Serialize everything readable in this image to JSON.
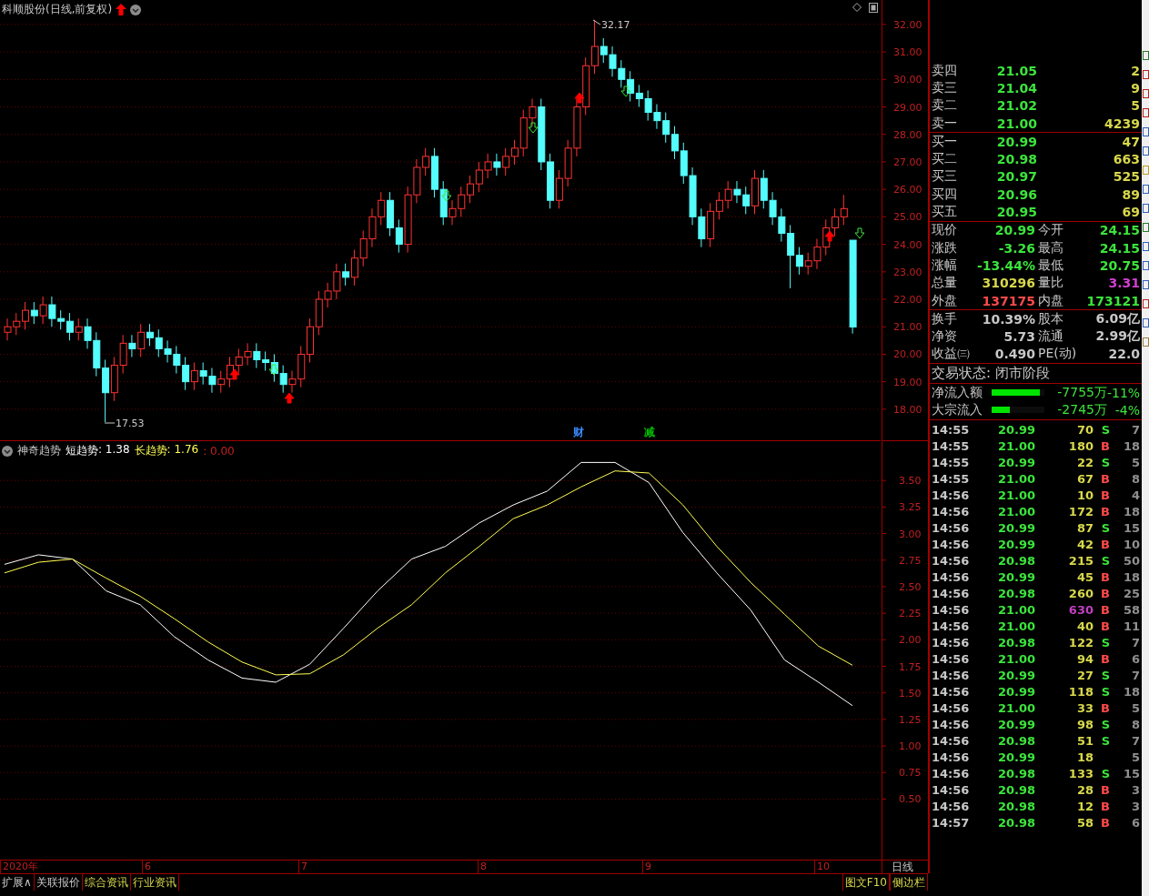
{
  "chart": {
    "title": "科顺股份(日线,前复权)",
    "high_label": "32.17",
    "low_label": "17.53",
    "event_marks": [
      {
        "label": "财",
        "color": "#3c8cff"
      },
      {
        "label": "减",
        "color": "#00c000"
      }
    ],
    "chart_data": {
      "type": "candlestick",
      "grid": true,
      "ylim": [
        16.87,
        32.89
      ],
      "yticks": [
        {
          "value": 32,
          "label": "32.00"
        },
        {
          "value": 31,
          "label": "31.00"
        },
        {
          "value": 30,
          "label": "30.00"
        },
        {
          "value": 29,
          "label": "29.00"
        },
        {
          "value": 28,
          "label": "28.00"
        },
        {
          "value": 27,
          "label": "27.00"
        },
        {
          "value": 26,
          "label": "26.00"
        },
        {
          "value": 25,
          "label": "25.00"
        },
        {
          "value": 24,
          "label": "24.00"
        },
        {
          "value": 23,
          "label": "23.00"
        },
        {
          "value": 22,
          "label": "22.00"
        },
        {
          "value": 21,
          "label": "21.00"
        },
        {
          "value": 20,
          "label": "20.00"
        },
        {
          "value": 19,
          "label": "19.00"
        },
        {
          "value": 18,
          "label": "18.00"
        }
      ],
      "ohlc": [
        [
          20.8,
          21.3,
          20.5,
          21.0
        ],
        [
          21.0,
          21.5,
          20.7,
          21.2
        ],
        [
          21.2,
          21.9,
          20.9,
          21.6
        ],
        [
          21.6,
          21.9,
          21.1,
          21.4
        ],
        [
          21.4,
          22.1,
          21.1,
          21.8
        ],
        [
          21.8,
          22.1,
          21.0,
          21.3
        ],
        [
          21.3,
          21.6,
          20.9,
          21.2
        ],
        [
          21.2,
          21.5,
          20.5,
          20.8
        ],
        [
          20.8,
          21.3,
          20.5,
          21.0
        ],
        [
          21.0,
          21.3,
          20.2,
          20.5
        ],
        [
          20.5,
          20.8,
          19.2,
          19.5
        ],
        [
          19.5,
          19.8,
          17.53,
          18.6
        ],
        [
          18.6,
          19.9,
          18.3,
          19.6
        ],
        [
          19.6,
          20.7,
          19.3,
          20.4
        ],
        [
          20.4,
          20.7,
          19.9,
          20.2
        ],
        [
          20.2,
          21.1,
          19.9,
          20.8
        ],
        [
          20.8,
          21.1,
          20.3,
          20.6
        ],
        [
          20.6,
          20.9,
          19.9,
          20.2
        ],
        [
          20.2,
          20.5,
          19.7,
          20.0
        ],
        [
          20.0,
          20.3,
          19.3,
          19.6
        ],
        [
          19.6,
          19.9,
          18.7,
          19.0
        ],
        [
          19.0,
          19.7,
          18.7,
          19.4
        ],
        [
          19.4,
          19.7,
          18.9,
          19.2
        ],
        [
          19.2,
          19.5,
          18.6,
          18.9
        ],
        [
          18.9,
          19.4,
          18.6,
          19.1
        ],
        [
          19.1,
          19.9,
          18.8,
          19.6
        ],
        [
          19.6,
          20.2,
          19.3,
          19.9
        ],
        [
          19.9,
          20.4,
          19.6,
          20.1
        ],
        [
          20.1,
          20.4,
          19.5,
          19.8
        ],
        [
          19.8,
          20.1,
          19.4,
          19.7
        ],
        [
          19.7,
          20.0,
          19.0,
          19.3
        ],
        [
          19.3,
          19.6,
          18.6,
          18.9
        ],
        [
          18.9,
          19.4,
          18.6,
          19.1
        ],
        [
          19.1,
          20.3,
          18.8,
          20.0
        ],
        [
          20.0,
          21.3,
          19.7,
          21.0
        ],
        [
          21.0,
          22.3,
          20.7,
          22.0
        ],
        [
          22.0,
          22.6,
          21.7,
          22.3
        ],
        [
          22.3,
          23.3,
          22.0,
          23.0
        ],
        [
          23.0,
          23.3,
          22.5,
          22.8
        ],
        [
          22.8,
          23.8,
          22.5,
          23.5
        ],
        [
          23.5,
          24.5,
          23.2,
          24.2
        ],
        [
          24.2,
          25.3,
          23.9,
          25.0
        ],
        [
          25.0,
          25.9,
          24.7,
          25.6
        ],
        [
          25.6,
          25.9,
          24.3,
          24.6
        ],
        [
          24.6,
          24.9,
          23.7,
          24.0
        ],
        [
          24.0,
          26.1,
          23.7,
          25.8
        ],
        [
          25.8,
          27.1,
          25.5,
          26.8
        ],
        [
          26.8,
          27.5,
          26.5,
          27.2
        ],
        [
          27.2,
          27.5,
          25.7,
          26.0
        ],
        [
          26.0,
          26.3,
          24.7,
          25.0
        ],
        [
          25.0,
          25.6,
          24.7,
          25.3
        ],
        [
          25.3,
          26.1,
          25.0,
          25.8
        ],
        [
          25.8,
          26.5,
          25.5,
          26.2
        ],
        [
          26.2,
          27.0,
          25.9,
          26.7
        ],
        [
          26.7,
          27.3,
          26.4,
          27.0
        ],
        [
          27.0,
          27.3,
          26.5,
          26.8
        ],
        [
          26.8,
          27.5,
          26.5,
          27.2
        ],
        [
          27.2,
          27.8,
          26.9,
          27.5
        ],
        [
          27.5,
          28.9,
          27.2,
          28.6
        ],
        [
          28.6,
          29.3,
          28.3,
          29.0
        ],
        [
          29.0,
          29.3,
          26.7,
          27.0
        ],
        [
          27.0,
          27.3,
          25.3,
          25.6
        ],
        [
          25.6,
          26.7,
          25.3,
          26.4
        ],
        [
          26.4,
          27.8,
          26.1,
          27.5
        ],
        [
          27.5,
          29.3,
          27.2,
          29.0
        ],
        [
          29.0,
          30.8,
          28.7,
          30.5
        ],
        [
          30.5,
          32.17,
          30.2,
          31.2
        ],
        [
          31.2,
          31.5,
          30.6,
          30.9
        ],
        [
          30.9,
          31.2,
          30.1,
          30.4
        ],
        [
          30.4,
          30.7,
          29.7,
          30.0
        ],
        [
          30.0,
          30.3,
          29.2,
          29.5
        ],
        [
          29.5,
          29.8,
          29.0,
          29.3
        ],
        [
          29.3,
          29.6,
          28.5,
          28.8
        ],
        [
          28.8,
          29.1,
          28.2,
          28.5
        ],
        [
          28.5,
          28.8,
          27.7,
          28.0
        ],
        [
          28.0,
          28.3,
          27.1,
          27.4
        ],
        [
          27.4,
          27.7,
          26.2,
          26.5
        ],
        [
          26.5,
          26.8,
          24.7,
          25.0
        ],
        [
          25.0,
          25.3,
          23.9,
          24.2
        ],
        [
          24.2,
          25.5,
          23.9,
          25.2
        ],
        [
          25.2,
          25.9,
          24.9,
          25.6
        ],
        [
          25.6,
          26.3,
          25.3,
          26.0
        ],
        [
          26.0,
          26.3,
          25.5,
          25.8
        ],
        [
          25.8,
          26.1,
          25.1,
          25.4
        ],
        [
          25.4,
          26.7,
          25.1,
          26.4
        ],
        [
          26.4,
          26.7,
          25.3,
          25.6
        ],
        [
          25.6,
          25.9,
          24.7,
          25.0
        ],
        [
          25.0,
          25.3,
          24.1,
          24.4
        ],
        [
          24.4,
          24.7,
          22.4,
          23.6
        ],
        [
          23.6,
          23.9,
          22.9,
          23.2
        ],
        [
          23.2,
          23.7,
          22.9,
          23.4
        ],
        [
          23.4,
          24.2,
          23.1,
          23.9
        ],
        [
          23.9,
          24.9,
          23.6,
          24.6
        ],
        [
          24.6,
          25.3,
          24.3,
          25.0
        ],
        [
          25.0,
          25.8,
          24.7,
          25.3
        ],
        [
          24.15,
          24.15,
          20.75,
          20.99
        ]
      ]
    }
  },
  "indicator": {
    "name": "神奇趋势",
    "legend": [
      {
        "value": ": 1.38",
        "color": "#ffffff"
      },
      {
        "value": ": 1.76",
        "color": "#ffff54"
      }
    ],
    "extra_value": ": 0.00",
    "chart_data": {
      "type": "line",
      "grid": true,
      "ylim": [
        -0.07,
        3.87
      ],
      "yticks": [
        {
          "value": 3.5,
          "label": "3.50"
        },
        {
          "value": 3.25,
          "label": "3.25"
        },
        {
          "value": 3,
          "label": "3.00"
        },
        {
          "value": 2.75,
          "label": "2.75"
        },
        {
          "value": 2.5,
          "label": "2.50"
        },
        {
          "value": 2.25,
          "label": "2.25"
        },
        {
          "value": 2,
          "label": "2.00"
        },
        {
          "value": 1.75,
          "label": "1.75"
        },
        {
          "value": 1.5,
          "label": "1.50"
        },
        {
          "value": 1.25,
          "label": "1.25"
        },
        {
          "value": 1,
          "label": "1.00"
        },
        {
          "value": 0.75,
          "label": "0.75"
        },
        {
          "value": 0.5,
          "label": "0.50"
        }
      ],
      "series": [
        {
          "name": "短趋势",
          "color": "#ffffff",
          "values": [
            2.71,
            2.8,
            2.76,
            2.46,
            2.33,
            2.03,
            1.81,
            1.64,
            1.6,
            1.77,
            2.11,
            2.46,
            2.76,
            2.88,
            3.1,
            3.27,
            3.4,
            3.67,
            3.67,
            3.48,
            3.01,
            2.63,
            2.28,
            1.81,
            1.6,
            1.38
          ]
        },
        {
          "name": "长趋势",
          "color": "#ffff54",
          "values": [
            2.63,
            2.73,
            2.76,
            2.58,
            2.41,
            2.2,
            1.98,
            1.79,
            1.67,
            1.68,
            1.86,
            2.11,
            2.33,
            2.63,
            2.88,
            3.14,
            3.27,
            3.44,
            3.59,
            3.57,
            3.27,
            2.88,
            2.54,
            2.24,
            1.94,
            1.76
          ]
        }
      ]
    }
  },
  "date_axis": {
    "labels": [
      "2020年",
      "6",
      "7",
      "8",
      "9",
      "10"
    ],
    "period": "日线"
  },
  "bottom_tabs": [
    {
      "label": "扩展∧",
      "kind": "plain"
    },
    {
      "label": "关联报价",
      "kind": "plain"
    },
    {
      "label": "综合资讯",
      "kind": "news"
    },
    {
      "label": "行业资讯",
      "kind": "news"
    }
  ],
  "bottom_right_tabs": [
    "图文F10",
    "侧边栏"
  ],
  "order_book": {
    "sell": [
      {
        "label": "卖四",
        "price": "21.05",
        "volume": "2"
      },
      {
        "label": "卖三",
        "price": "21.04",
        "volume": "9"
      },
      {
        "label": "卖二",
        "price": "21.02",
        "volume": "5"
      },
      {
        "label": "卖一",
        "price": "21.00",
        "volume": "4239"
      }
    ],
    "buy": [
      {
        "label": "买一",
        "price": "20.99",
        "volume": "47"
      },
      {
        "label": "买二",
        "price": "20.98",
        "volume": "663"
      },
      {
        "label": "买三",
        "price": "20.97",
        "volume": "525"
      },
      {
        "label": "买四",
        "price": "20.96",
        "volume": "89"
      },
      {
        "label": "买五",
        "price": "20.95",
        "volume": "69"
      }
    ]
  },
  "quote_stats": [
    [
      {
        "label": "现价",
        "value": "20.99",
        "color": "#3ce43c"
      },
      {
        "label": "今开",
        "value": "24.15",
        "color": "#3ce43c"
      }
    ],
    [
      {
        "label": "涨跌",
        "value": "-3.26",
        "color": "#3ce43c"
      },
      {
        "label": "最高",
        "value": "24.15",
        "color": "#3ce43c"
      }
    ],
    [
      {
        "label": "涨幅",
        "value": "-13.44%",
        "color": "#3ce43c"
      },
      {
        "label": "最低",
        "value": "20.75",
        "color": "#3ce43c"
      }
    ],
    [
      {
        "label": "总量",
        "value": "310296",
        "color": "#d8d84c"
      },
      {
        "label": "量比",
        "value": "3.31",
        "color": "#d040d0"
      }
    ],
    [
      {
        "label": "外盘",
        "value": "137175",
        "color": "#ff4a4a"
      },
      {
        "label": "内盘",
        "value": "173121",
        "color": "#3ce43c"
      }
    ]
  ],
  "fundamentals": [
    [
      {
        "label": "换手",
        "value": "10.39%"
      },
      {
        "label": "股本",
        "value": "6.09亿"
      }
    ],
    [
      {
        "label": "净资",
        "value": "5.73"
      },
      {
        "label": "流通",
        "value": "2.99亿"
      }
    ],
    [
      {
        "label": "收益㈢",
        "value": "0.490"
      },
      {
        "label": "PE(动)",
        "value": "22.0"
      }
    ]
  ],
  "trade_status": "交易状态: 闭市阶段",
  "fund_flow": [
    {
      "label": "净流入额",
      "level": 0.92,
      "amount": "-7755万",
      "percent": "-11%"
    },
    {
      "label": "大宗流入",
      "level": 0.34,
      "amount": "-2745万",
      "percent": "-4%"
    }
  ],
  "ticks": [
    {
      "time": "14:55",
      "price": "20.99",
      "volume": "70",
      "color": "#d8d84c",
      "side": "S",
      "kind": "sell",
      "count": "7"
    },
    {
      "time": "14:55",
      "price": "21.00",
      "volume": "180",
      "color": "#d8d84c",
      "side": "B",
      "kind": "buy",
      "count": "18"
    },
    {
      "time": "14:55",
      "price": "20.99",
      "volume": "22",
      "color": "#d8d84c",
      "side": "S",
      "kind": "sell",
      "count": "5"
    },
    {
      "time": "14:55",
      "price": "21.00",
      "volume": "67",
      "color": "#d8d84c",
      "side": "B",
      "kind": "buy",
      "count": "8"
    },
    {
      "time": "14:56",
      "price": "21.00",
      "volume": "10",
      "color": "#d8d84c",
      "side": "B",
      "kind": "buy",
      "count": "4"
    },
    {
      "time": "14:56",
      "price": "21.00",
      "volume": "172",
      "color": "#d8d84c",
      "side": "B",
      "kind": "buy",
      "count": "18"
    },
    {
      "time": "14:56",
      "price": "20.99",
      "volume": "87",
      "color": "#d8d84c",
      "side": "S",
      "kind": "sell",
      "count": "15"
    },
    {
      "time": "14:56",
      "price": "20.99",
      "volume": "42",
      "color": "#d8d84c",
      "side": "B",
      "kind": "buy",
      "count": "10"
    },
    {
      "time": "14:56",
      "price": "20.98",
      "volume": "215",
      "color": "#d8d84c",
      "side": "S",
      "kind": "sell",
      "count": "50"
    },
    {
      "time": "14:56",
      "price": "20.99",
      "volume": "45",
      "color": "#d8d84c",
      "side": "B",
      "kind": "buy",
      "count": "18"
    },
    {
      "time": "14:56",
      "price": "20.98",
      "volume": "260",
      "color": "#d8d84c",
      "side": "B",
      "kind": "buy",
      "count": "25"
    },
    {
      "time": "14:56",
      "price": "21.00",
      "volume": "630",
      "color": "#c040c0",
      "side": "B",
      "kind": "buy",
      "count": "58"
    },
    {
      "time": "14:56",
      "price": "21.00",
      "volume": "40",
      "color": "#d8d84c",
      "side": "B",
      "kind": "buy",
      "count": "11"
    },
    {
      "time": "14:56",
      "price": "20.98",
      "volume": "122",
      "color": "#d8d84c",
      "side": "S",
      "kind": "sell",
      "count": "7"
    },
    {
      "time": "14:56",
      "price": "21.00",
      "volume": "94",
      "color": "#d8d84c",
      "side": "B",
      "kind": "buy",
      "count": "6"
    },
    {
      "time": "14:56",
      "price": "20.99",
      "volume": "27",
      "color": "#d8d84c",
      "side": "S",
      "kind": "sell",
      "count": "7"
    },
    {
      "time": "14:56",
      "price": "20.99",
      "volume": "118",
      "color": "#d8d84c",
      "side": "S",
      "kind": "sell",
      "count": "18"
    },
    {
      "time": "14:56",
      "price": "21.00",
      "volume": "33",
      "color": "#d8d84c",
      "side": "B",
      "kind": "buy",
      "count": "5"
    },
    {
      "time": "14:56",
      "price": "20.99",
      "volume": "98",
      "color": "#d8d84c",
      "side": "S",
      "kind": "sell",
      "count": "8"
    },
    {
      "time": "14:56",
      "price": "20.98",
      "volume": "51",
      "color": "#d8d84c",
      "side": "S",
      "kind": "sell",
      "count": "7"
    },
    {
      "time": "14:56",
      "price": "20.99",
      "volume": "18",
      "color": "#d8d84c",
      "kind": "neutral",
      "count": "5"
    },
    {
      "time": "14:56",
      "price": "20.98",
      "volume": "133",
      "color": "#d8d84c",
      "side": "S",
      "kind": "sell",
      "count": "15"
    },
    {
      "time": "14:56",
      "price": "20.98",
      "volume": "28",
      "color": "#d8d84c",
      "side": "B",
      "kind": "buy",
      "count": "3"
    },
    {
      "time": "14:56",
      "price": "20.98",
      "volume": "12",
      "color": "#d8d84c",
      "side": "B",
      "kind": "buy",
      "count": "3"
    },
    {
      "time": "14:57",
      "price": "20.98",
      "volume": "58",
      "color": "#d8d84c",
      "side": "B",
      "kind": "buy",
      "count": "6"
    }
  ]
}
